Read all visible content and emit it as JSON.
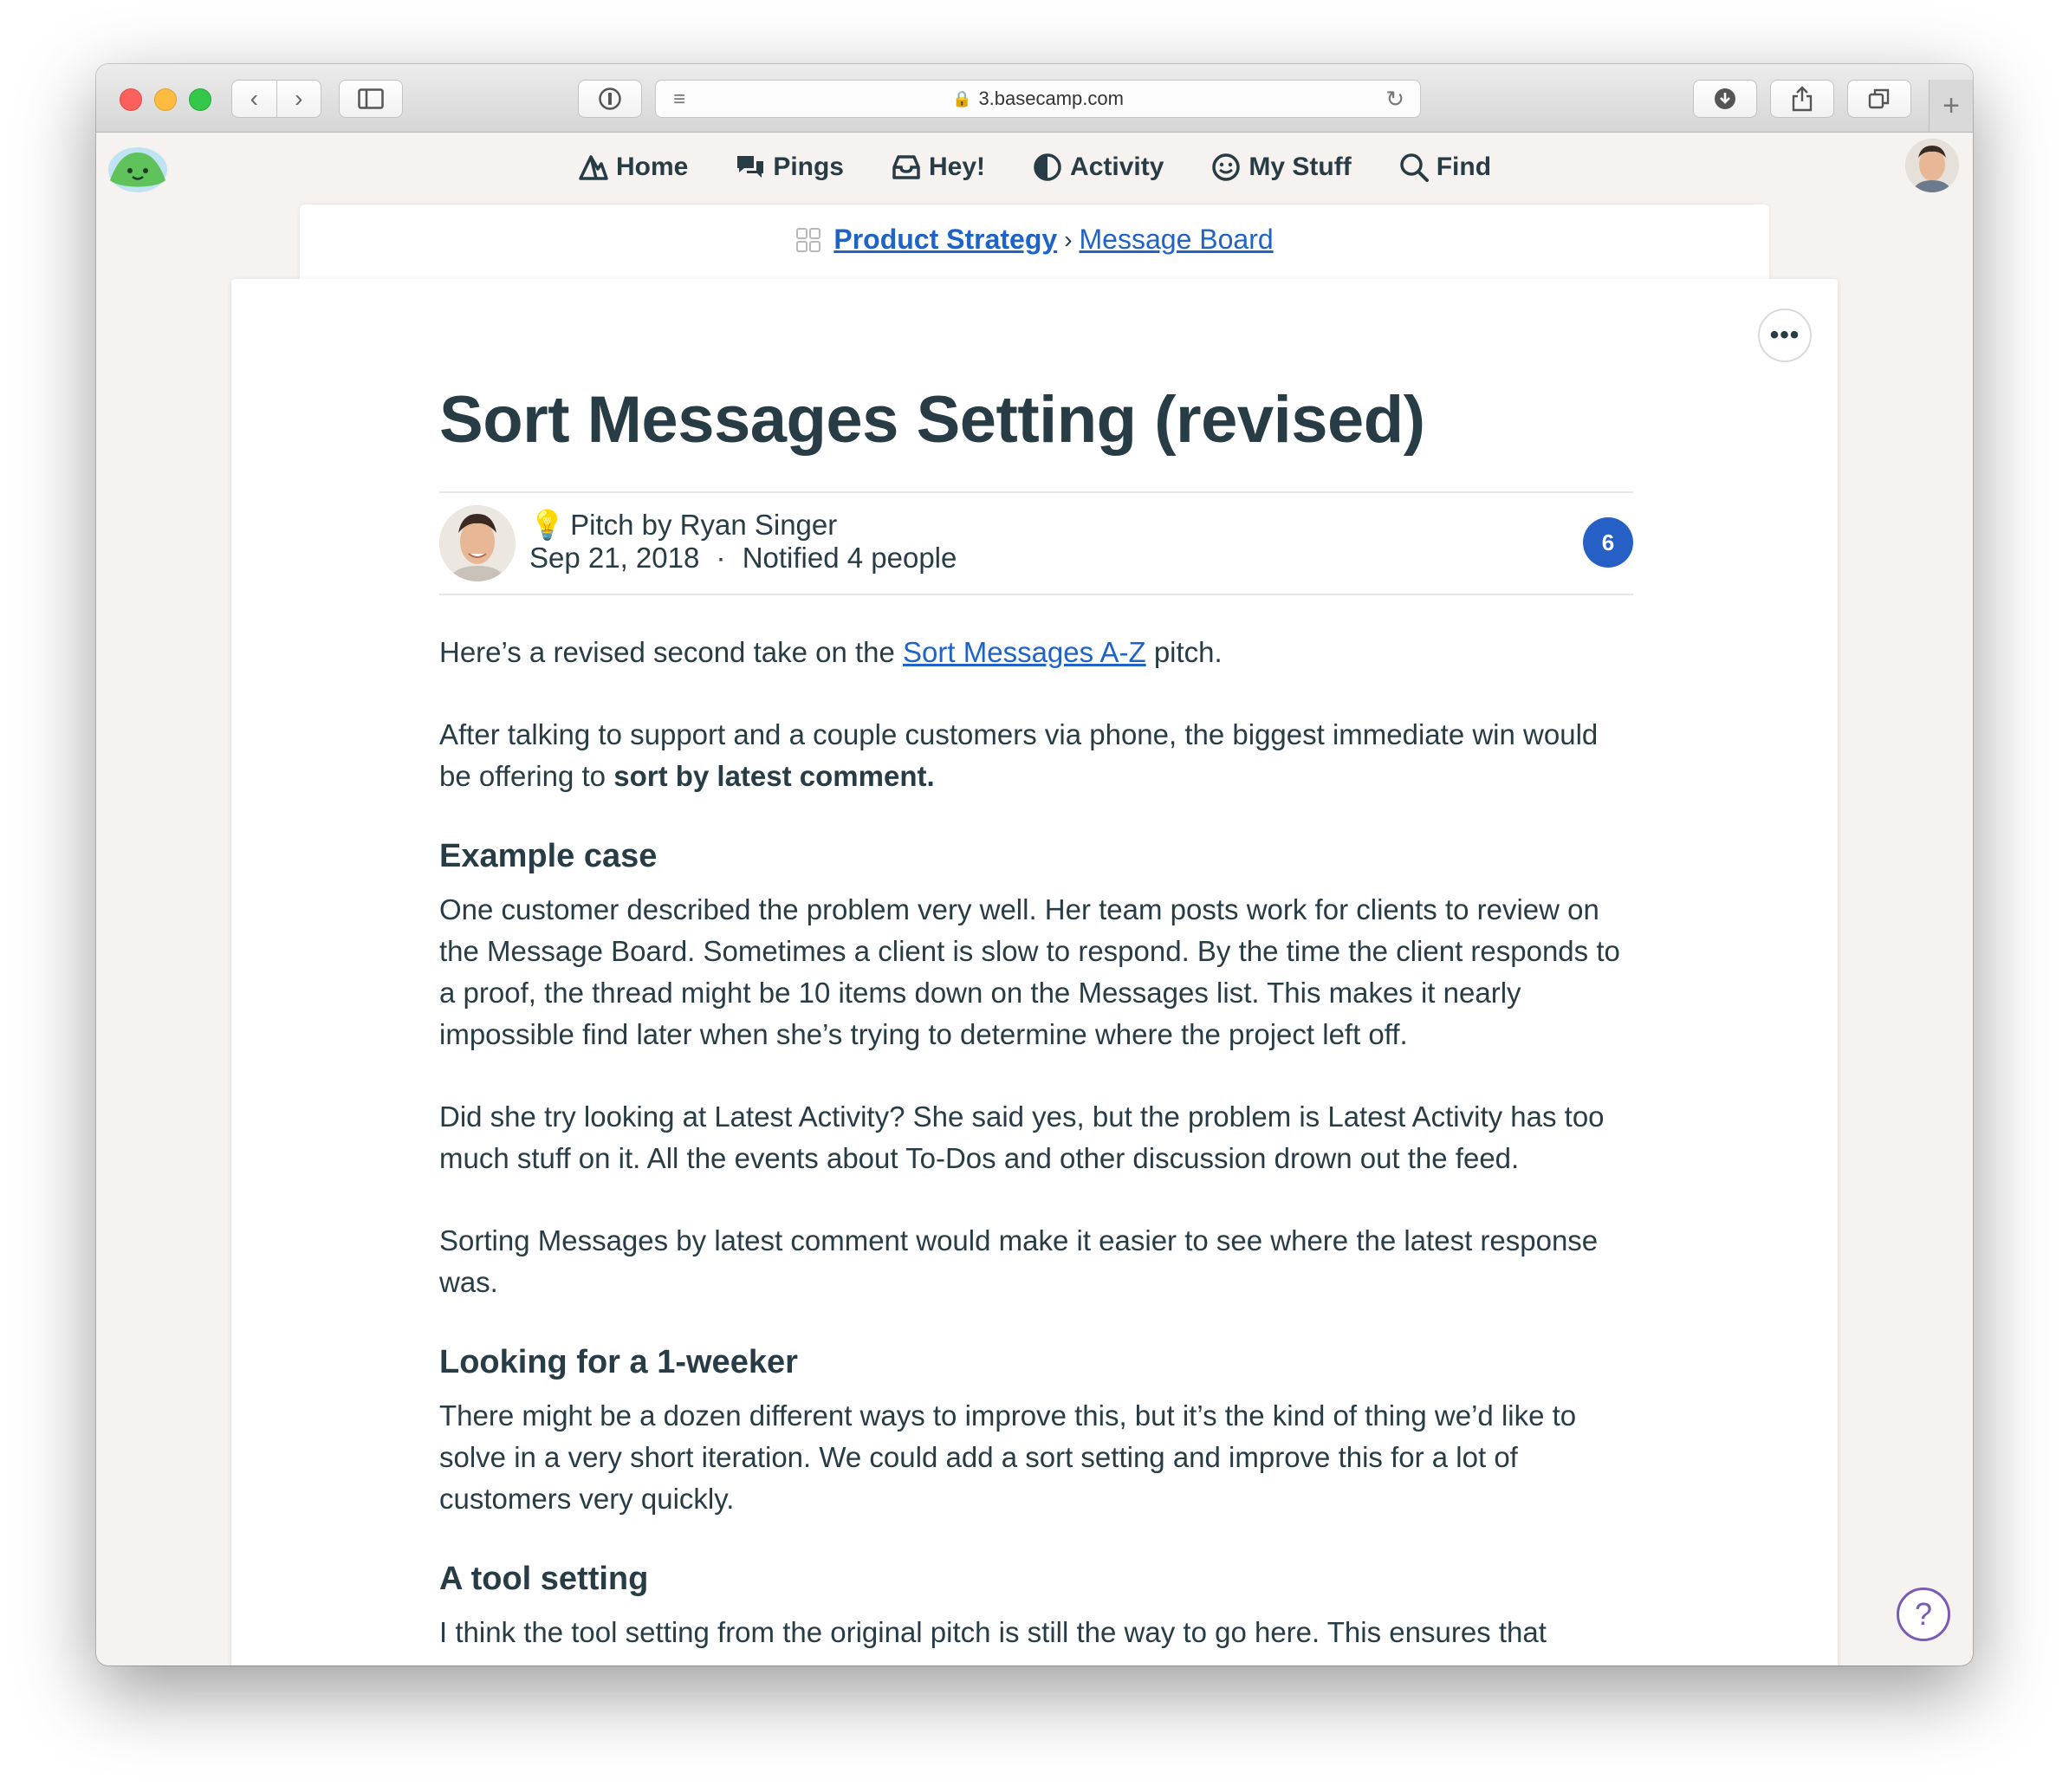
{
  "browser": {
    "url": "3.basecamp.com"
  },
  "nav": {
    "home": "Home",
    "pings": "Pings",
    "hey": "Hey!",
    "activity": "Activity",
    "my_stuff": "My Stuff",
    "find": "Find"
  },
  "breadcrumb": {
    "project": "Product Strategy",
    "separator": "›",
    "section": "Message Board"
  },
  "message": {
    "title": "Sort Messages Setting (revised)",
    "category": "Pitch by Ryan Singer",
    "date": "Sep 21, 2018",
    "dot": "·",
    "notified": "Notified 4 people",
    "comment_count": "6",
    "more_label": "•••"
  },
  "body": {
    "p1_before": "Here’s a revised second take on the ",
    "p1_link": "Sort Messages A-Z",
    "p1_after": " pitch.",
    "p2_before": "After talking to support and a couple customers via phone, the biggest immediate win would be offering to ",
    "p2_bold": "sort by latest comment.",
    "h_example": "Example case",
    "p3": "One customer described the problem very well. Her team posts work for clients to review on the Message Board. Sometimes a client is slow to respond. By the time the client responds to a proof, the thread might be 10 items down on the Messages list. This makes it nearly impossible find later when she’s trying to determine where the project left off.",
    "p4": "Did she try looking at Latest Activity? She said yes, but the problem is Latest Activity has too much stuff on it. All the events about To-Dos and other discussion drown out the feed.",
    "p5": "Sorting Messages by latest comment would make it easier to see where the latest response was.",
    "h_weeker": "Looking for a 1-weeker",
    "p6": "There might be a dozen different ways to improve this, but it’s the kind of thing we’d like to solve in a very short iteration. We could add a sort setting and improve this for a lot of customers very quickly.",
    "h_tool": "A tool setting",
    "p7": "I think the tool setting from the original pitch is still the way to go here. This ensures that"
  },
  "help": {
    "label": "?"
  },
  "colors": {
    "link": "#1f63c7",
    "badge": "#2660c6",
    "text": "#283c46",
    "help": "#7b5cb5"
  },
  "icons": {
    "home": "mountain-icon",
    "pings": "chat-bubbles-icon",
    "hey": "inbox-tray-icon",
    "activity": "half-circle-icon",
    "my_stuff": "smiley-icon",
    "find": "magnifier-icon"
  }
}
